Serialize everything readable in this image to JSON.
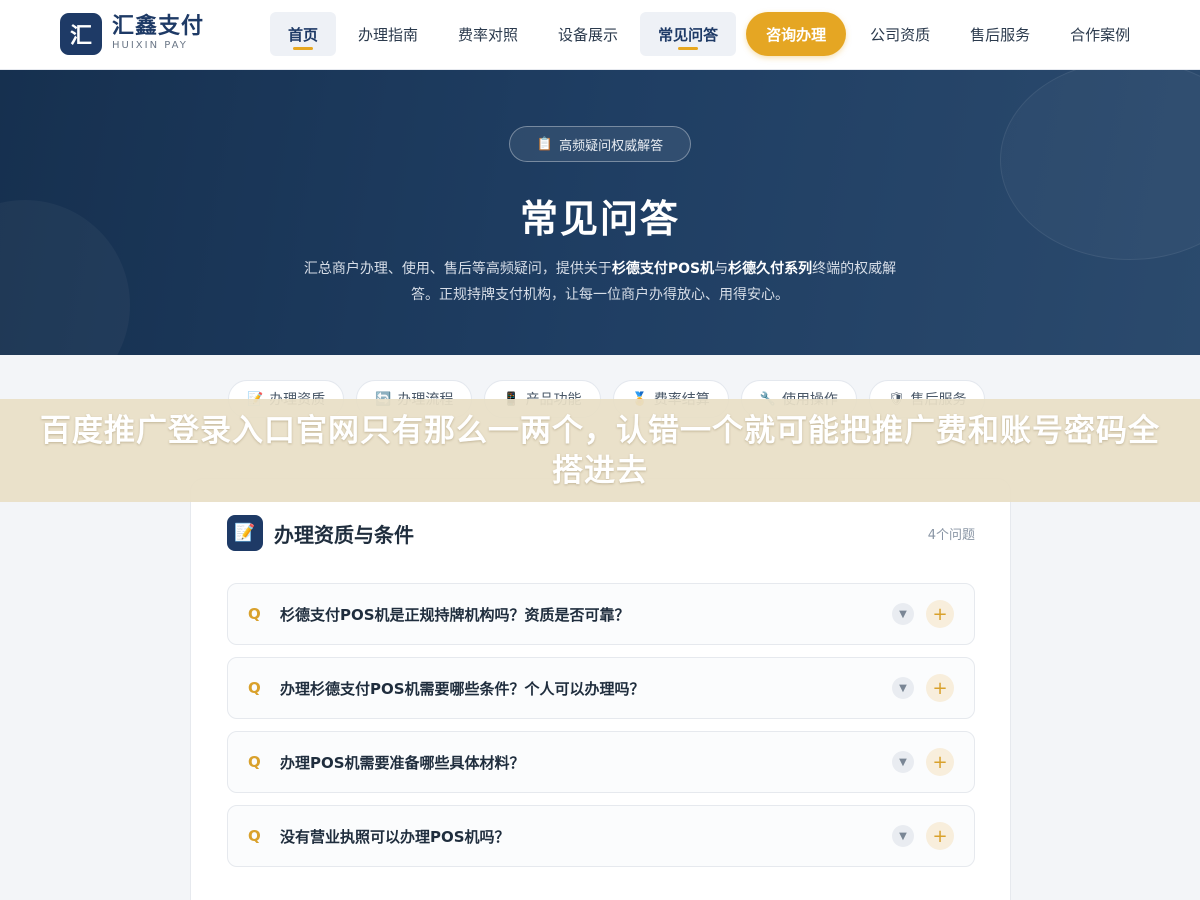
{
  "header": {
    "logo_mark": "汇",
    "logo_name": "汇鑫支付",
    "logo_sub": "HUIXIN PAY",
    "nav": [
      {
        "label": "首页",
        "active": true
      },
      {
        "label": "办理指南",
        "active": false
      },
      {
        "label": "费率对照",
        "active": false
      },
      {
        "label": "设备展示",
        "active": false
      },
      {
        "label": "常见问答",
        "active": true
      },
      {
        "label": "咨询办理",
        "cta": true
      },
      {
        "label": "公司资质",
        "active": false
      },
      {
        "label": "售后服务",
        "active": false
      },
      {
        "label": "合作案例",
        "active": false
      }
    ]
  },
  "hero": {
    "badge": "高频疑问权威解答",
    "badge_icon": "clipboard-icon",
    "title": "常见问答",
    "desc_part1": "汇总商户办理、使用、售后等高频疑问，提供关于",
    "desc_bold1": "杉德支付POS机",
    "desc_part2": "与",
    "desc_bold2": "杉德久付系列",
    "desc_part3": "终端的权威解答。正规持牌支付机构，让每一位商户办得放心、用得安心。"
  },
  "chips": [
    {
      "label": "办理资质",
      "icon": "memo-icon",
      "glyph": "📝"
    },
    {
      "label": "办理流程",
      "icon": "process-icon",
      "glyph": "🔄"
    },
    {
      "label": "产品功能",
      "icon": "phone-icon",
      "glyph": "📱"
    },
    {
      "label": "费率结算",
      "icon": "medal-icon",
      "glyph": "🏅"
    },
    {
      "label": "使用操作",
      "icon": "wrench-icon",
      "glyph": "🔧"
    },
    {
      "label": "售后服务",
      "icon": "shield-icon",
      "glyph": "🛡"
    }
  ],
  "overlay": {
    "text": "百度推广登录入口官网只有那么一两个，认错一个就可能把推广费和账号密码全搭进去"
  },
  "section": {
    "icon": "memo-icon",
    "title": "办理资质与条件",
    "count": "4个问题",
    "q_mark": "Q",
    "questions": [
      "杉德支付POS机是正规持牌机构吗？资质是否可靠？",
      "办理杉德支付POS机需要哪些条件？个人可以办理吗？",
      "办理POS机需要准备哪些具体材料？",
      "没有营业执照可以办理POS机吗？"
    ]
  },
  "colors": {
    "brand": "#1e3a66",
    "accent": "#e5a623",
    "hero_bg": "#1f3e63"
  }
}
